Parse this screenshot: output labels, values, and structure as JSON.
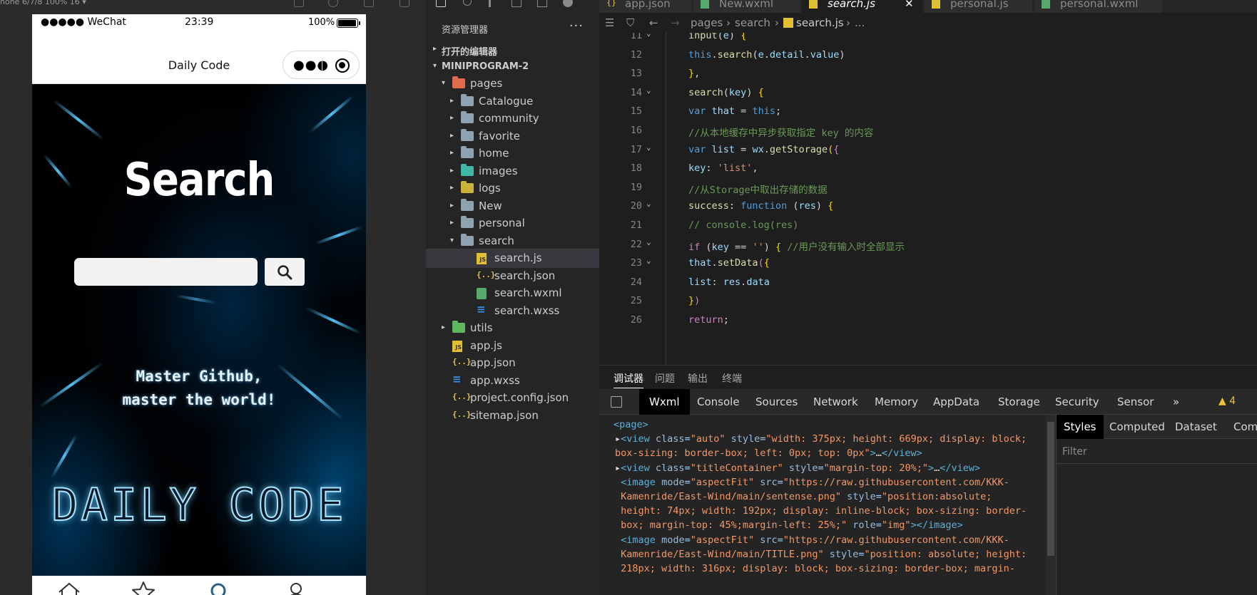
{
  "simulator": {
    "device_label": "hone 6/7/8 100% 16 ▾",
    "status": {
      "carrier": "●●●●● WeChat",
      "time": "23:39",
      "battery": "100%"
    },
    "nav_title": "Daily Code",
    "page": {
      "heading": "Search",
      "search_placeholder": "",
      "tagline_line1": "Master Github,",
      "tagline_line2": "master the world!",
      "brand_title": "DAILY CODE"
    },
    "tabbar": [
      "home-icon",
      "star-icon",
      "search-icon",
      "user-icon"
    ],
    "colors": {
      "accent": "#3aa8ff",
      "active_tab": "#2b5f86"
    }
  },
  "explorer": {
    "title": "资源管理器",
    "more": "···",
    "open_editors": "打开的编辑器",
    "project": "MINIPROGRAM-2",
    "tree": [
      {
        "name": "pages",
        "depth": 1,
        "arrow": "▾",
        "icon": "folder-red"
      },
      {
        "name": "Catalogue",
        "depth": 2,
        "arrow": "▸",
        "icon": "folder"
      },
      {
        "name": "community",
        "depth": 2,
        "arrow": "▸",
        "icon": "folder"
      },
      {
        "name": "favorite",
        "depth": 2,
        "arrow": "▸",
        "icon": "folder"
      },
      {
        "name": "home",
        "depth": 2,
        "arrow": "▸",
        "icon": "folder"
      },
      {
        "name": "images",
        "depth": 2,
        "arrow": "▸",
        "icon": "folder-teal"
      },
      {
        "name": "logs",
        "depth": 2,
        "arrow": "▸",
        "icon": "folder-yellow"
      },
      {
        "name": "New",
        "depth": 2,
        "arrow": "▸",
        "icon": "folder"
      },
      {
        "name": "personal",
        "depth": 2,
        "arrow": "▸",
        "icon": "folder"
      },
      {
        "name": "search",
        "depth": 2,
        "arrow": "▾",
        "icon": "folder"
      },
      {
        "name": "search.js",
        "depth": 3,
        "arrow": "",
        "icon": "js",
        "selected": true
      },
      {
        "name": "search.json",
        "depth": 3,
        "arrow": "",
        "icon": "json"
      },
      {
        "name": "search.wxml",
        "depth": 3,
        "arrow": "",
        "icon": "wxml"
      },
      {
        "name": "search.wxss",
        "depth": 3,
        "arrow": "",
        "icon": "css"
      },
      {
        "name": "utils",
        "depth": 1,
        "arrow": "▸",
        "icon": "folder-green"
      },
      {
        "name": "app.js",
        "depth": 1,
        "arrow": "",
        "icon": "js"
      },
      {
        "name": "app.json",
        "depth": 1,
        "arrow": "",
        "icon": "json"
      },
      {
        "name": "app.wxss",
        "depth": 1,
        "arrow": "",
        "icon": "css"
      },
      {
        "name": "project.config.json",
        "depth": 1,
        "arrow": "",
        "icon": "json"
      },
      {
        "name": "sitemap.json",
        "depth": 1,
        "arrow": "",
        "icon": "json"
      }
    ]
  },
  "editor": {
    "tabs": [
      {
        "name": "app.json",
        "icon": "json"
      },
      {
        "name": "New.wxml",
        "icon": "wxml"
      },
      {
        "name": "search.js",
        "icon": "js",
        "active": true,
        "close": "✕"
      },
      {
        "name": "personal.js",
        "icon": "js"
      },
      {
        "name": "personal.wxml",
        "icon": "wxml"
      }
    ],
    "breadcrumb": [
      "pages",
      "search",
      "search.js",
      "..."
    ],
    "lines": [
      {
        "n": "11",
        "fold": "⌄",
        "html": "<span class='fn'>input</span>(<span class='vr'>e</span>) <span class='br'>{</span>"
      },
      {
        "n": "12",
        "fold": "",
        "html": "<span class='kw'>this</span>.<span class='fn'>search</span>(<span class='vr'>e</span>.<span class='vr'>detail</span>.<span class='vr'>value</span>)"
      },
      {
        "n": "13",
        "fold": "",
        "html": "<span class='br'>}</span>,"
      },
      {
        "n": "14",
        "fold": "⌄",
        "html": "<span class='fn'>search</span>(<span class='vr'>key</span>) <span class='br'>{</span>"
      },
      {
        "n": "15",
        "fold": "",
        "html": "<span class='kw'>var</span> <span class='vr'>that</span> = <span class='kw'>this</span>;"
      },
      {
        "n": "16",
        "fold": "",
        "html": "<span class='cm'>//从本地缓存中异步获取指定 key 的内容</span>"
      },
      {
        "n": "17",
        "fold": "⌄",
        "html": "<span class='kw'>var</span> <span class='vr'>list</span> = <span class='vr'>wx</span>.<span class='fn'>getStorage</span><span class='br'>(</span><span class='kw2'>{</span>"
      },
      {
        "n": "18",
        "fold": "",
        "html": "<span class='vr'>key</span>: <span class='str'>'list'</span>,"
      },
      {
        "n": "19",
        "fold": "",
        "html": "<span class='cm'>//从Storage中取出存储的数据</span>"
      },
      {
        "n": "20",
        "fold": "⌄",
        "html": "<span class='fn'>success</span>: <span class='kw'>function</span> (<span class='vr'>res</span>) <span class='br'>{</span>"
      },
      {
        "n": "21",
        "fold": "",
        "html": "<span class='cm'>// console.log(res)</span>"
      },
      {
        "n": "22",
        "fold": "⌄",
        "html": "<span class='kw2'>if</span> (<span class='vr'>key</span> == <span class='str'>''</span>) <span class='br'>{</span> <span class='cm'>//用户没有输入时全部显示</span>"
      },
      {
        "n": "23",
        "fold": "⌄",
        "html": "<span class='vr'>that</span>.<span class='fn'>setData</span><span class='kw2'>(</span><span class='br'>{</span>"
      },
      {
        "n": "24",
        "fold": "",
        "html": "<span class='vr'>list</span>: <span class='vr'>res</span>.<span class='vr'>data</span>"
      },
      {
        "n": "25",
        "fold": "",
        "html": "<span class='br'>}</span><span class='kw2'>)</span>"
      },
      {
        "n": "26",
        "fold": "",
        "html": "<span class='kw2'>return</span>;"
      }
    ]
  },
  "panel": {
    "tabs": [
      "调试器",
      "问题",
      "输出",
      "终端"
    ],
    "devtools_tabs": [
      "Wxml",
      "Console",
      "Sources",
      "Network",
      "Memory",
      "AppData",
      "Storage",
      "Security",
      "Sensor"
    ],
    "more": "»",
    "warnings": "▲ 4",
    "elements": [
      "<span class='tagc'>&lt;page&gt;</span>",
      "<span class='txt'>▸</span><span class='tagc'>&lt;view</span> <span class='attr'>class</span>=<span class='val'>\"auto\"</span> <span class='attr'>style</span>=<span class='val'>\"width: 375px; height: 669px; display: block;</span>",
      "<span class='val'>box-sizing: border-box; left: 0px; top: 0px\"</span><span class='tagc'>&gt;</span><span class='txt'>…</span><span class='tagc'>&lt;/view&gt;</span>",
      "<span class='txt'>▸</span><span class='tagc'>&lt;view</span> <span class='attr'>class</span>=<span class='val'>\"titleContainer\"</span> <span class='attr'>style</span>=<span class='val'>\"margin-top: 20%;\"</span><span class='tagc'>&gt;</span><span class='txt'>…</span><span class='tagc'>&lt;/view&gt;</span>",
      " <span class='tagc'>&lt;image</span> <span class='attr'>mode</span>=<span class='val'>\"aspectFit\"</span> <span class='attr'>src</span>=<span class='val'>\"https://raw.githubusercontent.com/KKK-</span>",
      " <span class='val'>Kamenride/East-Wind/main/sentense.png\"</span> <span class='attr'>style</span>=<span class='val'>\"position:absolute;</span>",
      " <span class='val'>height: 74px; width: 192px; display: inline-block; box-sizing: border-</span>",
      " <span class='val'>box; margin-top: 45%;margin-left: 25%;\"</span> <span class='attr'>role</span>=<span class='val'>\"img\"</span><span class='tagc'>&gt;&lt;/image&gt;</span>",
      " <span class='tagc'>&lt;image</span> <span class='attr'>mode</span>=<span class='val'>\"aspectFit\"</span> <span class='attr'>src</span>=<span class='val'>\"https://raw.githubusercontent.com/KKK-</span>",
      " <span class='val'>Kamenride/East-Wind/main/TITLE.png\"</span> <span class='attr'>style</span>=<span class='val'>\"position: absolute; height:</span>",
      " <span class='val'>218px; width: 316px; display: block; box-sizing: border-box; margin-</span>"
    ],
    "styles_tabs": [
      "Styles",
      "Computed",
      "Dataset",
      "Comp"
    ],
    "filter_placeholder": "Filter"
  }
}
